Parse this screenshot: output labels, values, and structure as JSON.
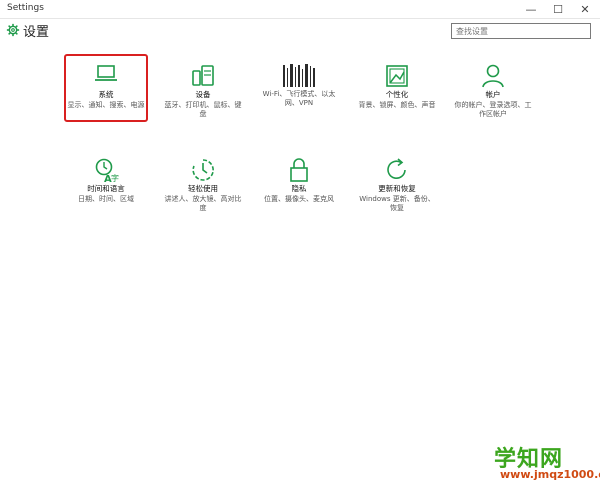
{
  "window": {
    "title": "Settings",
    "controls": {
      "minimize": "—",
      "maximize": "☐",
      "close": "✕"
    }
  },
  "header": {
    "title": "设置",
    "search_placeholder": "查找设置"
  },
  "accent_color": "#1f9a4a",
  "tiles": [
    {
      "icon": "laptop-icon",
      "name": "系统",
      "desc": "显示、通知、搜索、电源"
    },
    {
      "icon": "devices-icon",
      "name": "设备",
      "desc": "蓝牙、打印机、鼠标、键盘"
    },
    {
      "icon": "network-icon",
      "name": "",
      "desc": "Wi-Fi、飞行模式、以太网、VPN"
    },
    {
      "icon": "personalization-icon",
      "name": "个性化",
      "desc": "背景、锁屏、颜色、声音"
    },
    {
      "icon": "account-icon",
      "name": "帐户",
      "desc": "你的帐户、登录选项、工作区帐户"
    },
    {
      "icon": "time-language-icon",
      "name": "时间和语言",
      "desc": "日期、时间、区域"
    },
    {
      "icon": "ease-of-access-icon",
      "name": "轻松使用",
      "desc": "讲述人、放大镜、高对比度"
    },
    {
      "icon": "privacy-icon",
      "name": "隐私",
      "desc": "位置、摄像头、麦克风"
    },
    {
      "icon": "update-icon",
      "name": "更新和恢复",
      "desc": "Windows 更新、备份、恢复"
    }
  ],
  "watermark": {
    "brand": "学知网",
    "url": "www.jmqz1000.com"
  }
}
